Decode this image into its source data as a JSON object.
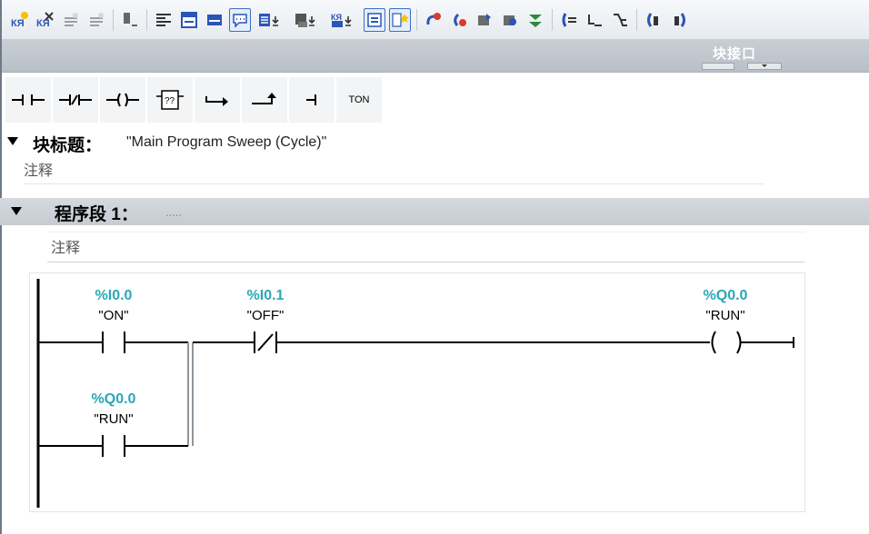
{
  "toolbar": {
    "icons": [
      "insert-network-icon",
      "delete-network-icon",
      "insert-row-icon",
      "add-row-icon",
      "toggle-absolute-icon",
      "expand-all-icon",
      "collapse-all-icon",
      "network-view-icon",
      "comment-icon",
      "show-all-operands-icon",
      "show-symbolic-icon",
      "symbol-info-icon",
      "operand-info-icon",
      "favorites-icon",
      "call-hierarchy-icon",
      "go-online-icon",
      "monitor-icon",
      "download-icon",
      "step-in-icon",
      "step-list-icon",
      "step-over-icon",
      "go-to-previous-icon",
      "go-to-next-icon"
    ]
  },
  "interface_label": "块接口",
  "palette": {
    "items": [
      "no-contact",
      "nc-contact",
      "output-coil",
      "empty-box",
      "open-branch",
      "close-branch",
      "insert-input",
      "ton"
    ],
    "ton_label": "TON"
  },
  "block": {
    "title_label": "块标题：",
    "title_value": "\"Main Program Sweep (Cycle)\"",
    "comment": "注释"
  },
  "network": {
    "title": "程序段 1：",
    "dots": ".....",
    "comment": "注释"
  },
  "ladder": {
    "contacts": [
      {
        "address": "%I0.0",
        "symbol": "\"ON\"",
        "type": "NO"
      },
      {
        "address": "%I0.1",
        "symbol": "\"OFF\"",
        "type": "NC"
      },
      {
        "address": "%Q0.0",
        "symbol": "\"RUN\"",
        "type": "NO"
      }
    ],
    "coil": {
      "address": "%Q0.0",
      "symbol": "\"RUN\"",
      "type": "coil"
    }
  },
  "colors": {
    "operand_address": "#2aa8b6",
    "active_button_border": "#3c6fc9",
    "network_header": "#c6ccd2"
  }
}
